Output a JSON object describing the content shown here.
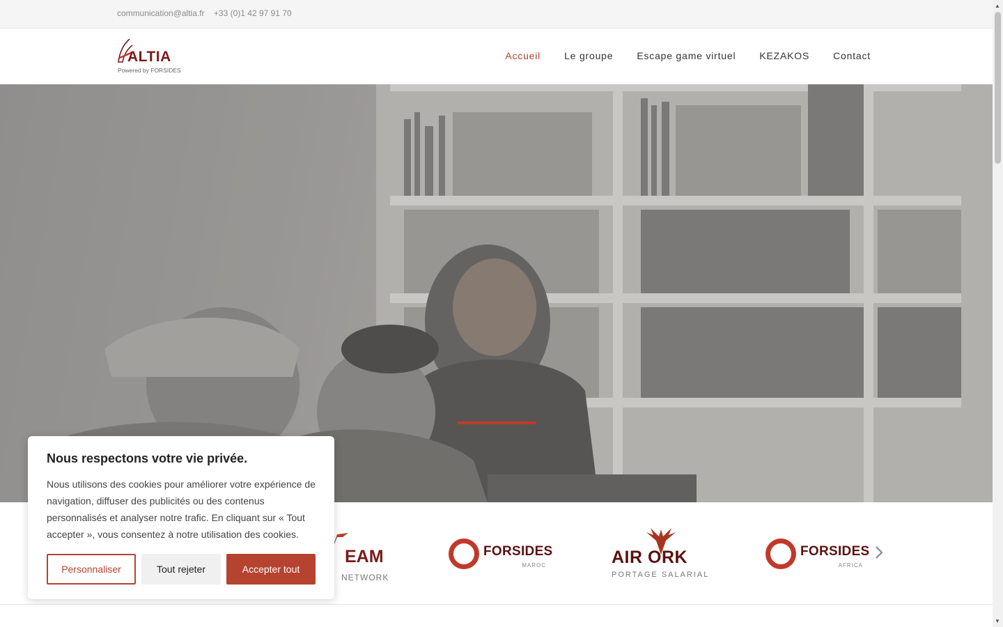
{
  "topbar": {
    "email": "communication@altia.fr",
    "phone": "+33 (0)1 42 97 91 70"
  },
  "logo": {
    "name": "ALTIA",
    "tagline": "Powered by FORSIDES"
  },
  "nav": {
    "items": [
      {
        "label": "Accueil",
        "active": true
      },
      {
        "label": "Le groupe",
        "active": false
      },
      {
        "label": "Escape game virtuel",
        "active": false
      },
      {
        "label": "KEZAKOS",
        "active": false
      },
      {
        "label": "Contact",
        "active": false
      }
    ]
  },
  "partners": {
    "team": {
      "main": "EAM",
      "sub": "NETWORK"
    },
    "forsides_maroc": {
      "main": "FORSIDES",
      "sub": "MAROC"
    },
    "airwork": {
      "main": "AIR ORK",
      "sub": "PORTAGE SALARIAL"
    },
    "forsides_africa": {
      "main": "FORSIDES",
      "sub": "AFRICA"
    },
    "next_icon": "chevron-right-icon"
  },
  "cookie_banner": {
    "title": "Nous respectons votre vie privée.",
    "text": "Nous utilisons des cookies pour améliorer votre expérience de navigation, diffuser des publicités ou des contenus personnalisés et analyser notre trafic. En cliquant sur « Tout accepter », vous consentez à notre utilisation des cookies.",
    "customize_label": "Personnaliser",
    "reject_label": "Tout rejeter",
    "accept_label": "Accepter tout"
  },
  "colors": {
    "accent": "#b5432f",
    "brand_dark": "#7a1a1a"
  }
}
